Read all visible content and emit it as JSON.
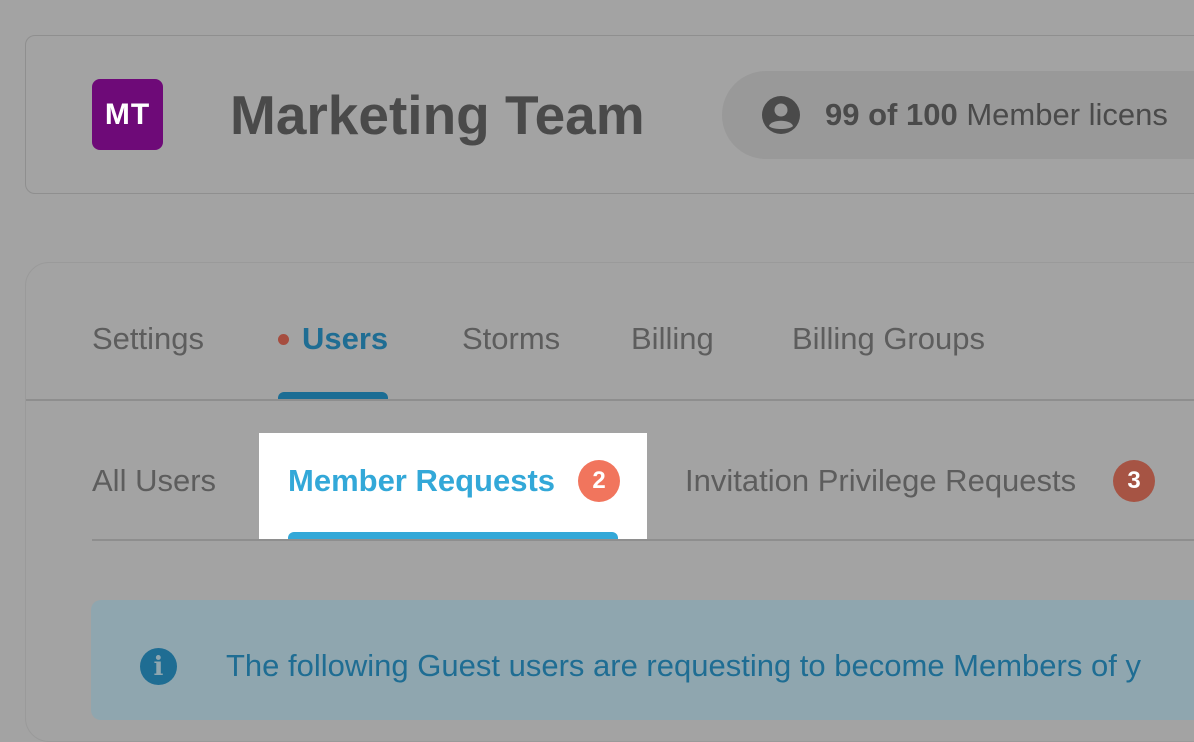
{
  "team": {
    "initials": "MT",
    "name": "Marketing Team",
    "avatar_color": "#6e0a78"
  },
  "licenses": {
    "icon": "user-circle-icon",
    "count": "99 of 100",
    "label": "Member licens"
  },
  "tabs": [
    {
      "label": "Settings"
    },
    {
      "label": "Users",
      "active": true,
      "has_notification_dot": true
    },
    {
      "label": "Storms"
    },
    {
      "label": "Billing"
    },
    {
      "label": "Billing Groups"
    }
  ],
  "subtabs": [
    {
      "label": "All Users"
    },
    {
      "label": "Member Requests",
      "active": true,
      "badge": "2"
    },
    {
      "label": "Invitation Privilege Requests",
      "badge": "3"
    }
  ],
  "info_banner": {
    "icon": "info-icon",
    "text": "The following Guest users are requesting to become Members of y"
  },
  "colors": {
    "accent_blue": "#33a8d8",
    "dark_blue": "#1f6d93",
    "badge_red": "#f1755d"
  }
}
